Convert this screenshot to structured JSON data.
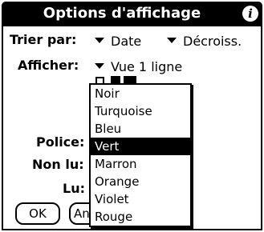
{
  "dialog": {
    "title": "Options d'affichage",
    "info_icon": "info-icon"
  },
  "sort": {
    "label": "Trier par:",
    "field_value": "Date",
    "order_value": "Décroiss."
  },
  "show": {
    "label": "Afficher:",
    "value": "Vue 1 ligne"
  },
  "fields": {
    "font_label": "Police:",
    "unread_label": "Non lu:",
    "read_label": "Lu:"
  },
  "buttons": {
    "ok_label": "OK",
    "partial_label": "An"
  },
  "color_popup": {
    "options": [
      "Noir",
      "Turquoise",
      "Bleu",
      "Vert",
      "Marron",
      "Orange",
      "Violet",
      "Rouge"
    ],
    "selected": "Vert"
  }
}
